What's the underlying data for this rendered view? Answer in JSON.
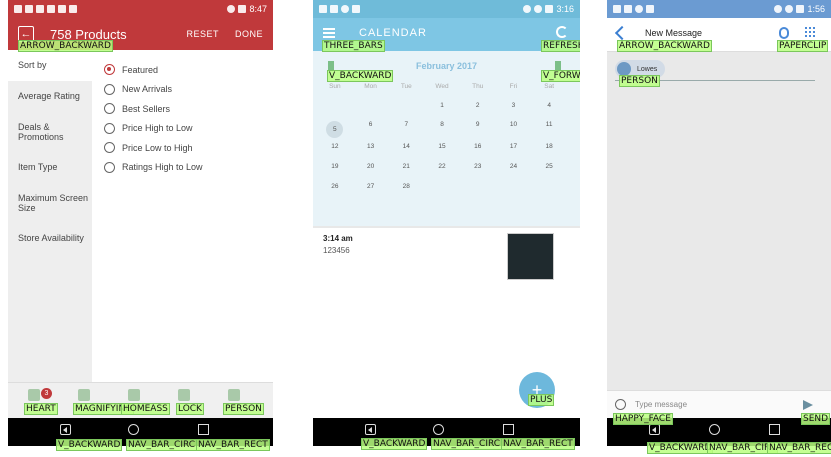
{
  "screen1": {
    "status": {
      "time": "8:47"
    },
    "header": {
      "back_tag": "ARROW_BACKWARD",
      "title": "758 Products",
      "reset": "RESET",
      "done": "DONE"
    },
    "sidebar": [
      {
        "label": "Sort by"
      },
      {
        "label": "Average Rating"
      },
      {
        "label": "Deals & Promotions"
      },
      {
        "label": "Item Type"
      },
      {
        "label": "Maximum Screen Size"
      },
      {
        "label": "Store Availability"
      }
    ],
    "sort_options": [
      {
        "label": "Featured",
        "selected": true
      },
      {
        "label": "New Arrivals",
        "selected": false
      },
      {
        "label": "Best Sellers",
        "selected": false
      },
      {
        "label": "Price High to Low",
        "selected": false
      },
      {
        "label": "Price Low to High",
        "selected": false
      },
      {
        "label": "Ratings High to Low",
        "selected": false
      }
    ],
    "bottom_nav": {
      "badge_count": "3",
      "tags": [
        "HEART",
        "MAGNIFYING",
        "HOMEASS",
        "LOCK",
        "PERSON"
      ]
    },
    "android_nav_tags": [
      "V_BACKWARD",
      "NAV_BAR_CIRC",
      "NAV_BAR_RECT"
    ]
  },
  "screen2": {
    "status": {
      "time": "3:16"
    },
    "header": {
      "title": "CALENDAR",
      "menu_tag": "THREE_BARS",
      "refresh_tag": "REFRESH"
    },
    "calendar": {
      "month": "February 2017",
      "prev_tag": "V_BACKWARD",
      "next_tag": "V_FORWARD",
      "weekdays": [
        "Sun",
        "Mon",
        "Tue",
        "Wed",
        "Thu",
        "Fri",
        "Sat"
      ],
      "weeks": [
        [
          "",
          "",
          "",
          "1",
          "2",
          "3",
          "4"
        ],
        [
          "5",
          "6",
          "7",
          "8",
          "9",
          "10",
          "11"
        ],
        [
          "12",
          "13",
          "14",
          "15",
          "16",
          "17",
          "18"
        ],
        [
          "19",
          "20",
          "21",
          "22",
          "23",
          "24",
          "25"
        ],
        [
          "26",
          "27",
          "28",
          "",
          "",
          "",
          ""
        ]
      ],
      "today": "5"
    },
    "event": {
      "time": "3:14 am",
      "text": "123456"
    },
    "fab_tag": "PLUS",
    "android_nav_tags": [
      "V_BACKWARD",
      "NAV_BAR_CIRC",
      "NAV_BAR_RECT"
    ]
  },
  "screen3": {
    "status": {
      "time": "1:56"
    },
    "header": {
      "title": "New Message",
      "back_tag": "ARROW_BACKWARD",
      "clip_tag": "PAPERCLIP"
    },
    "recipient": {
      "name": "Lowes",
      "tag": "PERSON"
    },
    "composer": {
      "placeholder": "Type message",
      "emoji_tag": "HAPPY_FACE",
      "send_tag": "SEND"
    },
    "android_nav_tags": [
      "V_BACKWARD",
      "NAV_BAR_CIRC",
      "NAV_BAR_RECT"
    ]
  }
}
